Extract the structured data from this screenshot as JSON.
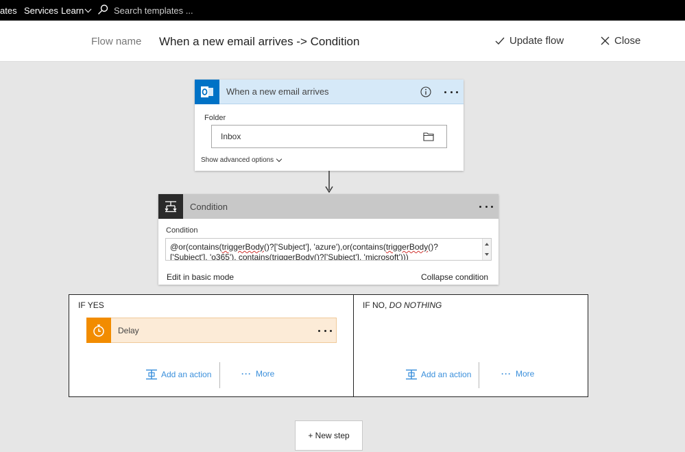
{
  "topnav": {
    "items": [
      "ates",
      "Services",
      "Learn"
    ],
    "search_placeholder": "Search templates ..."
  },
  "header": {
    "flow_name_label": "Flow name",
    "flow_name_value": "When a new email arrives -> Condition",
    "update_label": "Update flow",
    "close_label": "Close"
  },
  "trigger": {
    "title": "When a new email arrives",
    "icon": "outlook-icon",
    "accent": "#0072c6",
    "folder_label": "Folder",
    "folder_value": "Inbox",
    "advanced_label": "Show advanced options"
  },
  "condition": {
    "title": "Condition",
    "field_label": "Condition",
    "expression_line1_a": "@or(contains(",
    "expression_line1_b": "triggerBody",
    "expression_line1_c": "()?['Subject'], 'azure'),or(contains(",
    "expression_line1_d": "triggerBody",
    "expression_line1_e": "()?",
    "expression_line2": "['Subject'], 'o365'), contains(triggerBody()?['Subject'], 'microsoft')))",
    "edit_basic_label": "Edit in basic mode",
    "collapse_label": "Collapse condition"
  },
  "branch_yes": {
    "title": "IF YES",
    "delay_title": "Delay",
    "add_action_label": "Add an action",
    "more_label": "More"
  },
  "branch_no": {
    "title_a": "IF NO, ",
    "title_b": "DO NOTHING",
    "add_action_label": "Add an action",
    "more_label": "More"
  },
  "new_step_label": "+ New step",
  "colors": {
    "link": "#3a8fdb",
    "delay_accent": "#f28c00",
    "condition_header": "#c8c8c8",
    "trigger_header": "#d6e9f8"
  }
}
